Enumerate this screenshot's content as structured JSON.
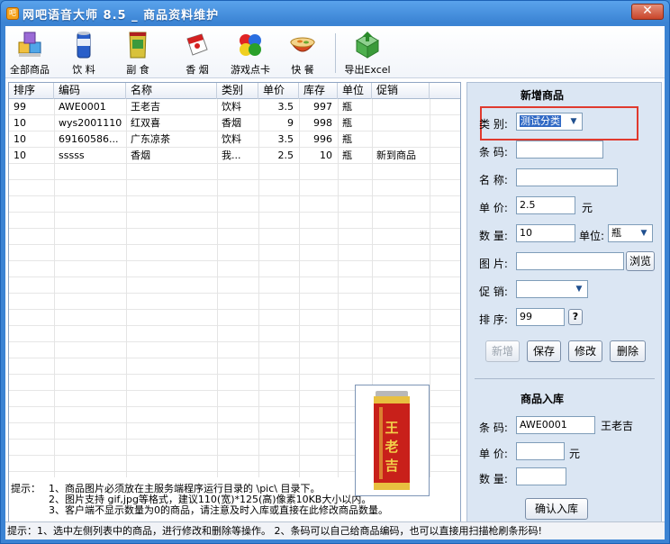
{
  "window": {
    "title": "网吧语音大师 8.5 _ 商品资料维护",
    "close": "✕",
    "app_icon": "吧"
  },
  "toolbar": [
    {
      "label": "全部商品",
      "icon": "all-goods-icon"
    },
    {
      "label": "饮 料",
      "icon": "drink-can-icon"
    },
    {
      "label": "副 食",
      "icon": "snack-bag-icon"
    },
    {
      "label": "香 烟",
      "icon": "cigarette-pack-icon"
    },
    {
      "label": "游戏点卡",
      "icon": "game-card-icon"
    },
    {
      "label": "快 餐",
      "icon": "noodle-bowl-icon"
    },
    {
      "label": "导出Excel",
      "icon": "export-excel-icon"
    }
  ],
  "table": {
    "columns": [
      "排序",
      "编码",
      "名称",
      "类别",
      "单价",
      "库存",
      "单位",
      "促销"
    ],
    "rows": [
      [
        "99",
        "AWE0001",
        "王老吉",
        "饮料",
        "3.5",
        "997",
        "瓶",
        ""
      ],
      [
        "10",
        "wys2001110",
        "红双喜",
        "香烟",
        "9",
        "998",
        "瓶",
        ""
      ],
      [
        "10",
        "69160586...",
        "广东凉茶",
        "饮料",
        "3.5",
        "996",
        "瓶",
        ""
      ],
      [
        "10",
        "sssss",
        "香烟",
        "我...",
        "2.5",
        "10",
        "瓶",
        "新到商品"
      ]
    ]
  },
  "tips": {
    "prefix": "提示：",
    "line1": "1、商品图片必须放在主服务端程序运行目录的 \\pic\\ 目录下。",
    "line2": "2、图片支持 gif,jpg等格式，建议110(宽)*125(高)像素10KB大小以内。",
    "line3": "3、客户端不显示数量为0的商品，请注意及时入库或直接在此修改商品数量。"
  },
  "product_image": {
    "text": "王老吉"
  },
  "new_product": {
    "title": "新增商品",
    "category_label": "类 别:",
    "category_value": "测试分类",
    "barcode_label": "条 码:",
    "barcode_value": "",
    "name_label": "名 称:",
    "name_value": "",
    "price_label": "单 价:",
    "price_value": "2.5",
    "price_unit": "元",
    "qty_label": "数 量:",
    "qty_value": "10",
    "unit_label": "单位:",
    "unit_value": "瓶",
    "image_label": "图 片:",
    "image_value": "",
    "browse": "浏览",
    "promo_label": "促 销:",
    "promo_value": "",
    "sort_label": "排 序:",
    "sort_value": "99",
    "help": "?",
    "btn_add": "新增",
    "btn_save": "保存",
    "btn_edit": "修改",
    "btn_delete": "删除"
  },
  "stock_in": {
    "title": "商品入库",
    "barcode_label": "条 码:",
    "barcode_value": "AWE0001",
    "barcode_name": "王老吉",
    "price_label": "单 价:",
    "price_value": "",
    "price_unit": "元",
    "qty_label": "数 量:",
    "qty_value": "",
    "confirm": "确认入库"
  },
  "status_bar": "提示：1、选中左侧列表中的商品，进行修改和删除等操作。 2、条码可以自己给商品编码，也可以直接用扫描枪刷条形码!",
  "colors": {
    "title_bar": "#3b83d3",
    "panel_bg": "#dbe6f3",
    "highlight_box": "#e03a2e",
    "selection": "#316ac5"
  }
}
